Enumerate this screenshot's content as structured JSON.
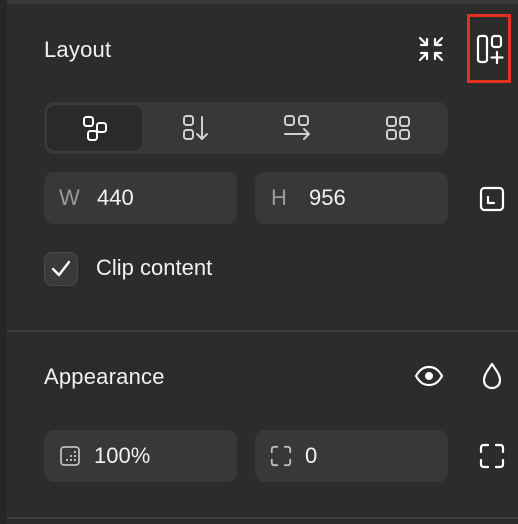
{
  "layout": {
    "title": "Layout",
    "actions": {
      "collapse_icon": "collapse-arrows-icon",
      "add_layout_icon": "add-layout-icon"
    },
    "modes": [
      {
        "name": "free",
        "icon": "free-layout-icon",
        "active": true
      },
      {
        "name": "vertical",
        "icon": "vertical-stack-icon",
        "active": false
      },
      {
        "name": "horizontal",
        "icon": "horizontal-stack-icon",
        "active": false
      },
      {
        "name": "grid",
        "icon": "grid-layout-icon",
        "active": false
      }
    ],
    "width_label": "W",
    "width_value": "440",
    "height_label": "H",
    "height_value": "956",
    "fit_icon": "resize-fit-icon",
    "clip_label": "Clip content",
    "clip_checked": true
  },
  "appearance": {
    "title": "Appearance",
    "actions": {
      "visibility_icon": "eye-icon",
      "fill_icon": "drop-icon"
    },
    "opacity_value": "100%",
    "corner_radius_value": "0",
    "corner_expand_icon": "corners-icon"
  },
  "colors": {
    "panel_bg": "#2c2c2c",
    "field_bg": "#383838",
    "highlight": "#e4301c"
  }
}
